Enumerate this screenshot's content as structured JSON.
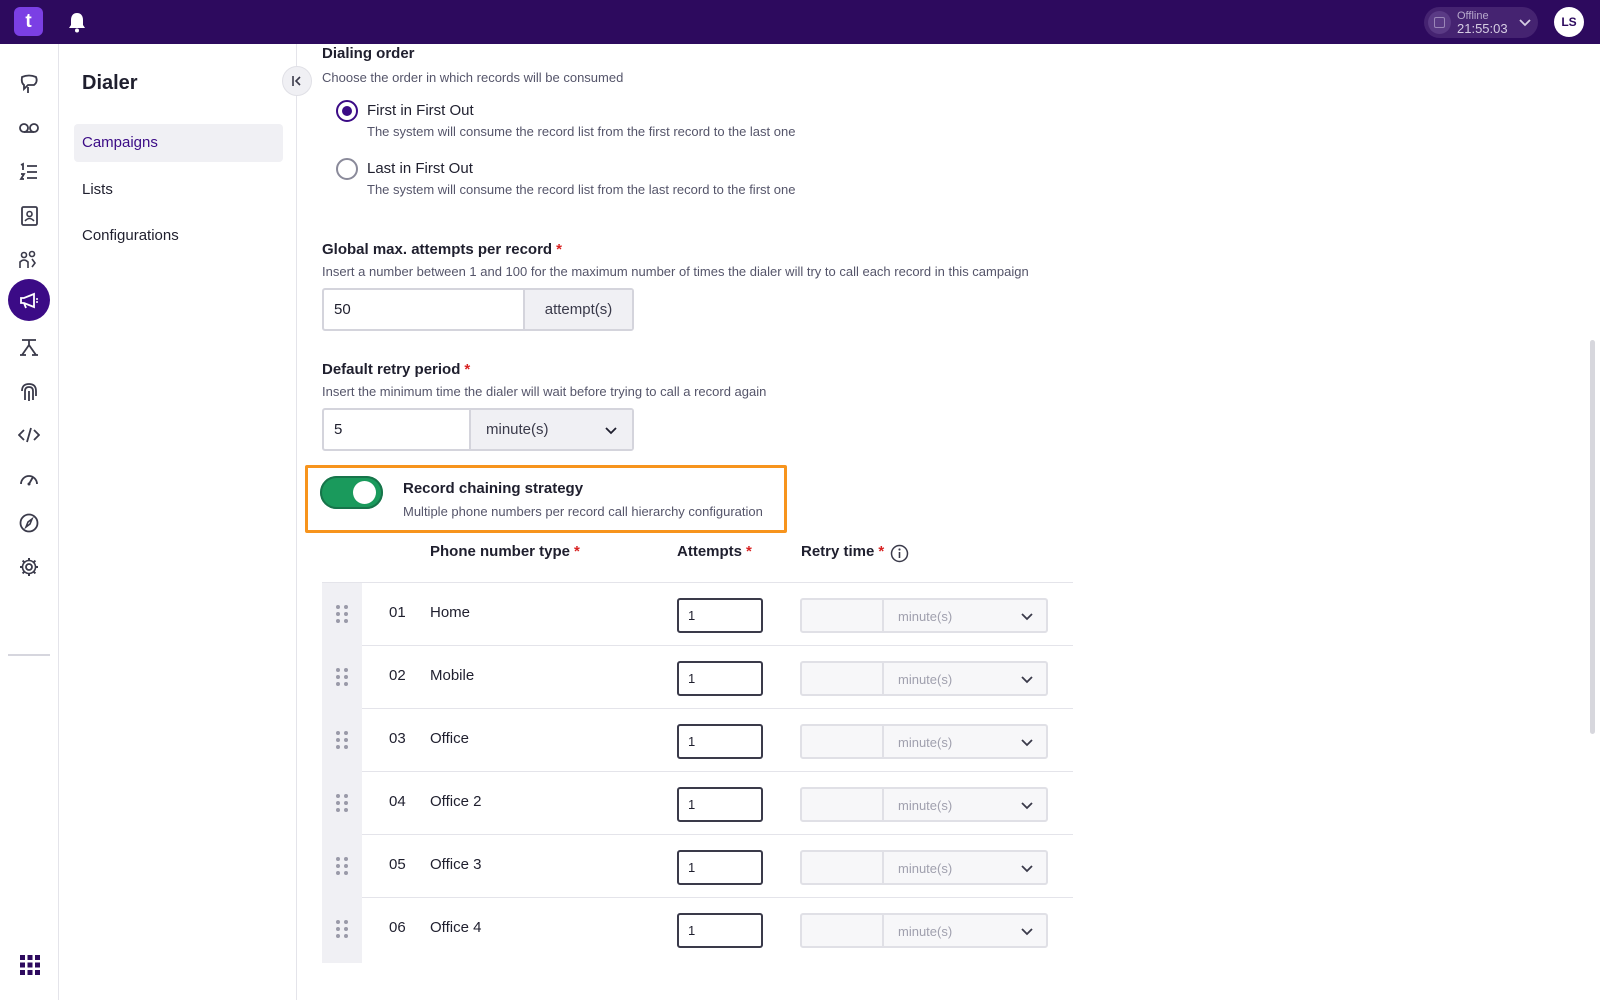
{
  "topbar": {
    "logo_text": "t",
    "status_label": "Offline",
    "status_time": "21:55:03",
    "avatar_initials": "LS"
  },
  "rail": {
    "items": [
      "speech-bubble-icon",
      "voicemail-icon",
      "list-icon",
      "contacts-icon",
      "team-icon",
      "megaphone-icon",
      "flow-icon",
      "fingerprint-icon",
      "code-icon",
      "dashboard-icon",
      "compass-icon",
      "gear-icon"
    ],
    "active": "megaphone-icon"
  },
  "subnav": {
    "title": "Dialer",
    "items": [
      {
        "label": "Campaigns",
        "active": true
      },
      {
        "label": "Lists",
        "active": false
      },
      {
        "label": "Configurations",
        "active": false
      }
    ]
  },
  "dialing_order": {
    "title": "Dialing order",
    "hint": "Choose the order in which records will be consumed",
    "options": [
      {
        "label": "First in First Out",
        "desc": "The system will consume the record list from the first record to the last one",
        "checked": true
      },
      {
        "label": "Last in First Out",
        "desc": "The system will consume the record list from the last record to the first one",
        "checked": false
      }
    ]
  },
  "max_attempts": {
    "title": "Global max. attempts per record",
    "required": "*",
    "hint": "Insert a number between 1 and 100 for the maximum number of times the dialer will try to call each record in this campaign",
    "value": "50",
    "unit": "attempt(s)"
  },
  "retry_period": {
    "title": "Default retry period",
    "required": "*",
    "hint": "Insert the minimum time the dialer will wait before trying to call a record again",
    "value": "5",
    "unit": "minute(s)"
  },
  "record_chaining": {
    "enabled": true,
    "title": "Record chaining strategy",
    "desc": "Multiple phone numbers per record call hierarchy configuration",
    "accent": "#f7941d",
    "toggle_color": "#1a9a5c"
  },
  "table": {
    "headers": {
      "phone_type": "Phone number type",
      "attempts": "Attempts",
      "retry_time": "Retry time",
      "required": "*"
    },
    "rows": [
      {
        "num": "01",
        "type": "Home",
        "attempts": "1",
        "unit": "minute(s)"
      },
      {
        "num": "02",
        "type": "Mobile",
        "attempts": "1",
        "unit": "minute(s)"
      },
      {
        "num": "03",
        "type": "Office",
        "attempts": "1",
        "unit": "minute(s)"
      },
      {
        "num": "04",
        "type": "Office 2",
        "attempts": "1",
        "unit": "minute(s)"
      },
      {
        "num": "05",
        "type": "Office 3",
        "attempts": "1",
        "unit": "minute(s)"
      },
      {
        "num": "06",
        "type": "Office 4",
        "attempts": "1",
        "unit": "minute(s)"
      }
    ]
  }
}
